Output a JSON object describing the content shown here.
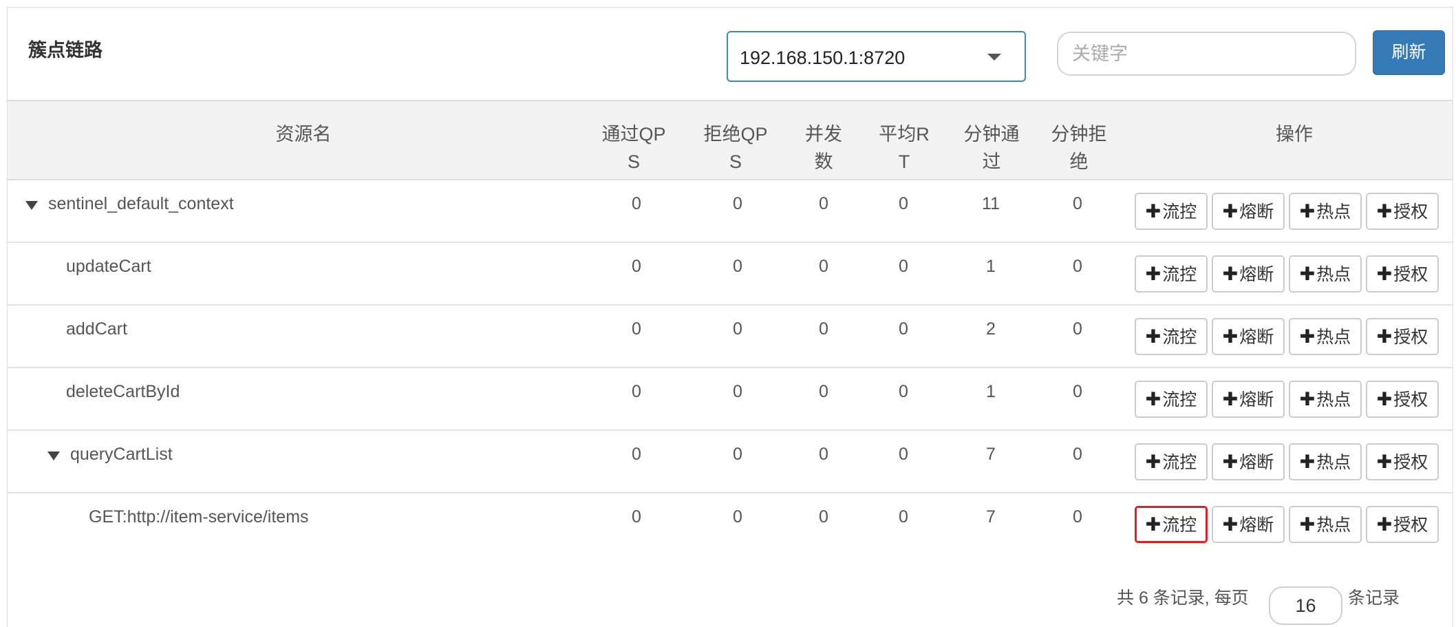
{
  "panel": {
    "title": "簇点链路",
    "machine_select": "192.168.150.1:8720",
    "search_placeholder": "关键字",
    "refresh_label": "刷新"
  },
  "table": {
    "headers": {
      "resource": "资源名",
      "pass_qps": [
        "通过QP",
        "S"
      ],
      "block_qps": [
        "拒绝QP",
        "S"
      ],
      "concurrency": [
        "并发",
        "数"
      ],
      "avg_rt": [
        "平均R",
        "T"
      ],
      "minute_pass": [
        "分钟通",
        "过"
      ],
      "minute_block": [
        "分钟拒",
        "绝"
      ],
      "ops": "操作"
    },
    "op_labels": [
      "流控",
      "熔断",
      "热点",
      "授权"
    ],
    "rows": [
      {
        "name": "sentinel_default_context",
        "values": [
          "0",
          "0",
          "0",
          "0",
          "11",
          "0"
        ]
      },
      {
        "name": "updateCart",
        "values": [
          "0",
          "0",
          "0",
          "0",
          "1",
          "0"
        ]
      },
      {
        "name": "addCart",
        "values": [
          "0",
          "0",
          "0",
          "0",
          "2",
          "0"
        ]
      },
      {
        "name": "deleteCartById",
        "values": [
          "0",
          "0",
          "0",
          "0",
          "1",
          "0"
        ]
      },
      {
        "name": "queryCartList",
        "values": [
          "0",
          "0",
          "0",
          "0",
          "7",
          "0"
        ]
      },
      {
        "name": "GET:http://item-service/items",
        "values": [
          "0",
          "0",
          "0",
          "0",
          "7",
          "0"
        ]
      }
    ]
  },
  "pager": {
    "prefix": "共 6 条记录, 每页",
    "page_size": "16",
    "suffix": "条记录"
  },
  "colors": {
    "primary": "#337ab7",
    "highlight": "#e0201e"
  }
}
